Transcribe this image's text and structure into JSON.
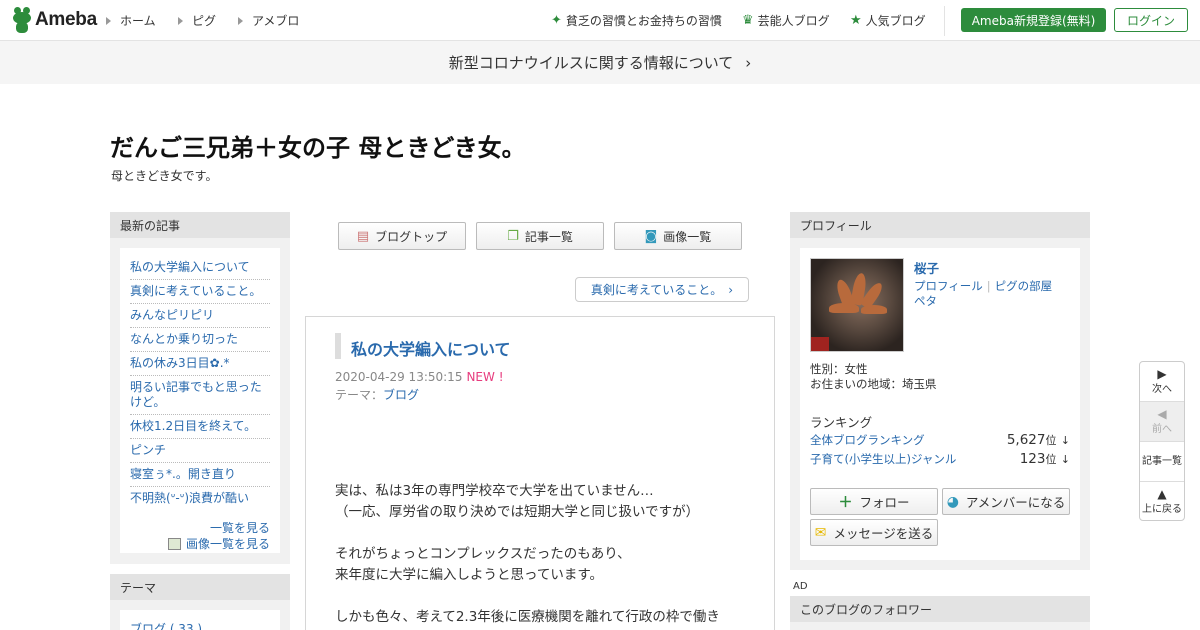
{
  "header": {
    "logo_text": "Ameba",
    "nav": [
      "ホーム",
      "ピグ",
      "アメブロ"
    ],
    "right_links": [
      "貧乏の習慣とお金持ちの習慣",
      "芸能人ブログ",
      "人気ブログ"
    ],
    "register_label": "Ameba新規登録(無料)",
    "login_label": "ログイン"
  },
  "notice": {
    "text": "新型コロナウイルスに関する情報について"
  },
  "blog": {
    "title": "だんご三兄弟＋女の子 母ときどき女。",
    "description": "母ときどき女です。"
  },
  "left": {
    "recent_heading": "最新の記事",
    "recent_items": [
      "私の大学編入について",
      "真剣に考えていること。",
      "みんなピリピリ",
      "なんとか乗り切った",
      "私の休み3日目✿.*",
      "明るい記事でもと思ったけど。",
      "休校1.2日目を終えて。",
      "ピンチ",
      "寝室ぅ*.。開き直り",
      "不明熱(ᐡ-ᐡ)浪費が酷い"
    ],
    "see_list": "一覧を見る",
    "see_images": "画像一覧を見る",
    "theme_heading": "テーマ",
    "theme_item": "ブログ ( 33 )"
  },
  "center": {
    "tabs": [
      "ブログトップ",
      "記事一覧",
      "画像一覧"
    ],
    "prev_article": "真剣に考えていること。",
    "article": {
      "title": "私の大学編入について",
      "date": "2020-04-29 13:50:15",
      "new_badge": "NEW !",
      "theme_label": "テーマ：",
      "theme_value": "ブログ",
      "body_lines": [
        "実は、私は3年の専門学校卒で大学を出ていません…",
        "（一応、厚労省の取り決めでは短期大学と同じ扱いですが）",
        "",
        "それがちょっとコンプレックスだったのもあり、",
        "来年度に大学に編入しようと思っています。",
        "",
        "しかも色々、考えて2.3年後に医療機関を離れて行政の枠で働き"
      ]
    }
  },
  "right": {
    "profile_heading": "プロフィール",
    "name": "桜子",
    "links": [
      "プロフィール",
      "ピグの部屋",
      "ペタ"
    ],
    "gender": "性別：女性",
    "location": "お住まいの地域：埼玉県",
    "ranking_heading": "ランキング",
    "rankings": [
      {
        "label": "全体ブログランキング",
        "value": "5,627",
        "unit": "位",
        "arrow": "↓"
      },
      {
        "label": "子育て(小学生以上)ジャンル",
        "value": "123",
        "unit": "位",
        "arrow": "↓"
      }
    ],
    "follow_label": "フォロー",
    "member_label": "アメンバーになる",
    "message_label": "メッセージを送る",
    "ad_label": "AD",
    "followers_heading": "このブログのフォロワー"
  },
  "floatnav": {
    "next": "次へ",
    "prev": "前へ",
    "list": "記事一覧",
    "top": "上に戻る"
  },
  "colors": {
    "brand_green": "#2d8c3c",
    "link_blue": "#2a6aad",
    "new_pink": "#e73c7e"
  }
}
